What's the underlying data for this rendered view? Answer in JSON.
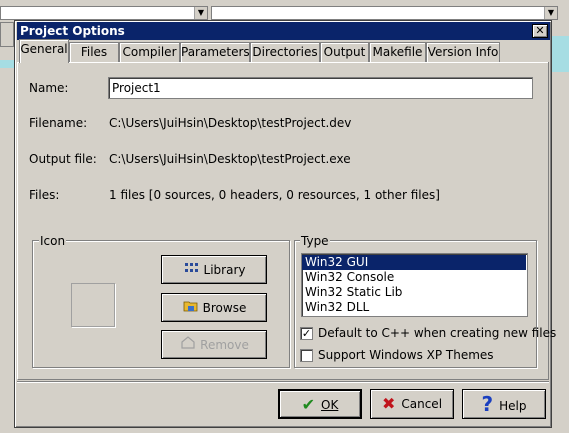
{
  "dialog": {
    "title": "Project Options",
    "close_glyph": "✕"
  },
  "tabs": [
    {
      "label": "General"
    },
    {
      "label": "Files"
    },
    {
      "label": "Compiler"
    },
    {
      "label": "Parameters"
    },
    {
      "label": "Directories"
    },
    {
      "label": "Output"
    },
    {
      "label": "Makefile"
    },
    {
      "label": "Version Info"
    }
  ],
  "general": {
    "name_label": "Name:",
    "name_value": "Project1",
    "filename_label": "Filename:",
    "filename_value": "C:\\Users\\JuiHsin\\Desktop\\testProject.dev",
    "output_label": "Output file:",
    "output_value": "C:\\Users\\JuiHsin\\Desktop\\testProject.exe",
    "files_label": "Files:",
    "files_value": "1 files [0 sources, 0 headers, 0 resources, 1 other files]"
  },
  "icon_group": {
    "title": "Icon",
    "library_label": "Library",
    "browse_label": "Browse",
    "remove_label": "Remove",
    "library_icon": "library-icon",
    "browse_icon": "folder-icon",
    "remove_icon": "house-icon"
  },
  "type_group": {
    "title": "Type",
    "options": [
      "Win32 GUI",
      "Win32 Console",
      "Win32 Static Lib",
      "Win32 DLL"
    ],
    "selected": "Win32 GUI",
    "default_cpp_label": "Default to C++ when creating new files",
    "default_cpp_checked": true,
    "xp_themes_label": "Support Windows XP Themes",
    "xp_themes_checked": false
  },
  "buttons": {
    "ok_label": "OK",
    "cancel_label": "Cancel",
    "help_label": "Help",
    "ok_glyph": "✔",
    "cancel_glyph": "✖",
    "help_glyph": "?"
  },
  "colors": {
    "titlebar": "#0a246a",
    "selection": "#0a246a",
    "ok_check": "#1f8a1f",
    "cancel_x": "#c0141c",
    "help_q": "#1a3fbf",
    "background_strip": "#a6dde3"
  }
}
